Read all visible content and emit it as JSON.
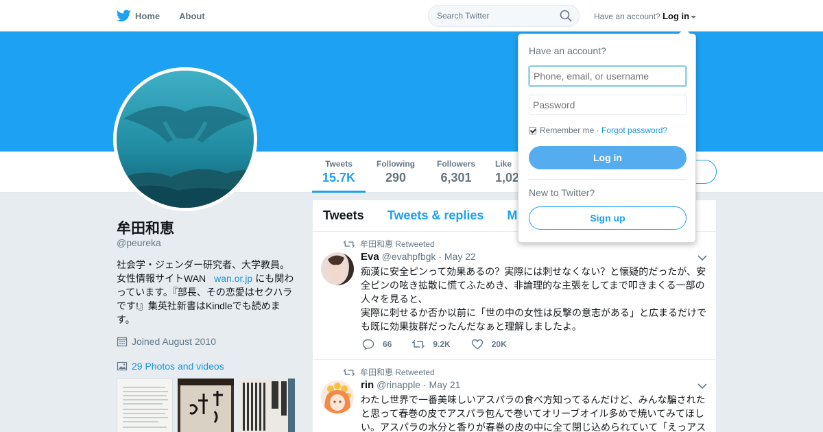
{
  "nav": {
    "logo_icon": "twitter-bird-icon",
    "home_label": "Home",
    "about_label": "About",
    "search_placeholder": "Search Twitter",
    "account_prompt": "Have an account?",
    "login_label": "Log in"
  },
  "colors": {
    "brand": "#1da1f2",
    "banner": "#1da1f2",
    "text": "#14171a",
    "muted": "#657786"
  },
  "profile": {
    "name": "牟田和恵",
    "handle": "@peureka",
    "bio_part1": "社会学・ジェンダー研究者、大学教員。女性情報サイトWAN",
    "bio_link": "wan.or.jp",
    "bio_part2": "にも関わっています。『部長、その恋愛はセクハラです!』集英社新書はKindleでも読めます。",
    "joined": "Joined August 2010",
    "photos": "29 Photos and videos"
  },
  "stats": [
    {
      "label": "Tweets",
      "value": "15.7K"
    },
    {
      "label": "Following",
      "value": "290"
    },
    {
      "label": "Followers",
      "value": "6,301"
    },
    {
      "label": "Like",
      "value": "1,02"
    }
  ],
  "timeline": {
    "tabs": [
      "Tweets",
      "Tweets & replies",
      "M"
    ],
    "tweets": [
      {
        "retweeted_by": "牟田和恵 Retweeted",
        "name": "Eva",
        "handle": "@evahpfbgk",
        "date": "· May 22",
        "text": "痴漢に安全ピンって効果あるの？実際には刺せなくない？と懐疑的だったが、安全ピンの呟き拡散に慌てふためき、非論理的な主張をしてまで叩きまくる一部の人々を見ると、\n実際に刺せるか否か以前に「世の中の女性は反撃の意志がある」と広まるだけでも既に効果抜群だったんだなぁと理解しましたよ。",
        "replies": "66",
        "retweets": "9.2K",
        "likes": "20K"
      },
      {
        "retweeted_by": "牟田和恵 Retweeted",
        "name": "rin",
        "handle": "@rinapple",
        "date": "· May 21",
        "text": "わたし世界で一番美味しいアスパラの食べ方知ってるんだけど、みんな騙されたと思って春巻の皮でアスパラ包んで巻いてオリーブオイル多めで焼いてみてほしい。アスパラの水分と香りが春巻の皮の中に全て閉じ込められていて「えっアス"
      }
    ]
  },
  "login_dropdown": {
    "title": "Have an account?",
    "phone_placeholder": "Phone, email, or username",
    "password_placeholder": "Password",
    "remember_label": "Remember me ·",
    "forgot_label": "Forgot password?",
    "login_button": "Log in",
    "new_prompt": "New to Twitter?",
    "signup_button": "Sign up"
  }
}
